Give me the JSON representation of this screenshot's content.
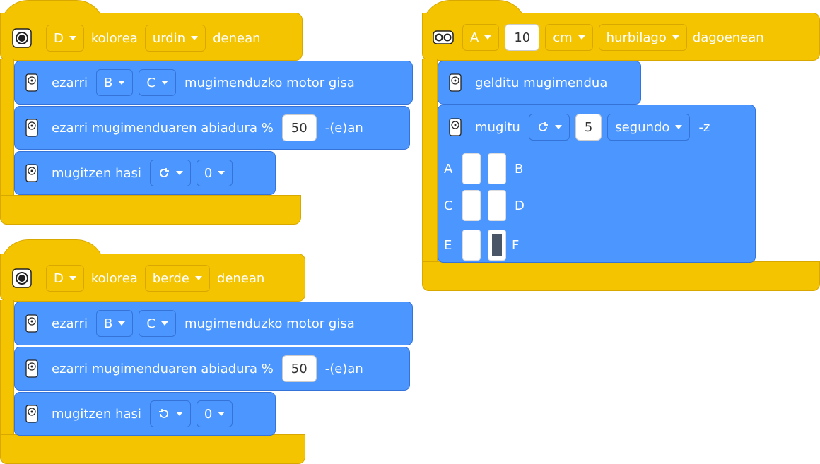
{
  "stack1": {
    "port": "D",
    "label_color": "kolorea",
    "color": "urdin",
    "label_when": "denean",
    "b1_set": "ezarri",
    "b1_p1": "B",
    "b1_p2": "C",
    "b1_suffix": "mugimenduzko motor gisa",
    "b2_text": "ezarri mugimenduaren abiadura %",
    "b2_val": "50",
    "b2_suffix": "-(e)an",
    "b3_text": "mugitzen hasi",
    "b3_dir": "cw",
    "b3_val": "0"
  },
  "stack2": {
    "port": "D",
    "label_color": "kolorea",
    "color": "berde",
    "label_when": "denean",
    "b1_set": "ezarri",
    "b1_p1": "B",
    "b1_p2": "C",
    "b1_suffix": "mugimenduzko motor gisa",
    "b2_text": "ezarri mugimenduaren abiadura %",
    "b2_val": "50",
    "b2_suffix": "-(e)an",
    "b3_text": "mugitzen hasi",
    "b3_dir": "ccw",
    "b3_val": "0"
  },
  "stack3": {
    "port": "A",
    "distance": "10",
    "unit": "cm",
    "compare": "hurbilago",
    "label_when": "dagoenean",
    "b1_text": "gelditu mugimendua",
    "b2_text": "mugitu",
    "b2_val": "5",
    "b2_unit": "segundo",
    "b2_suffix": "-z",
    "ports": [
      "A",
      "B",
      "C",
      "D",
      "E",
      "F"
    ],
    "selected_port": "F"
  },
  "colors": {
    "event": "#F5C400",
    "motion": "#4C97FF"
  }
}
